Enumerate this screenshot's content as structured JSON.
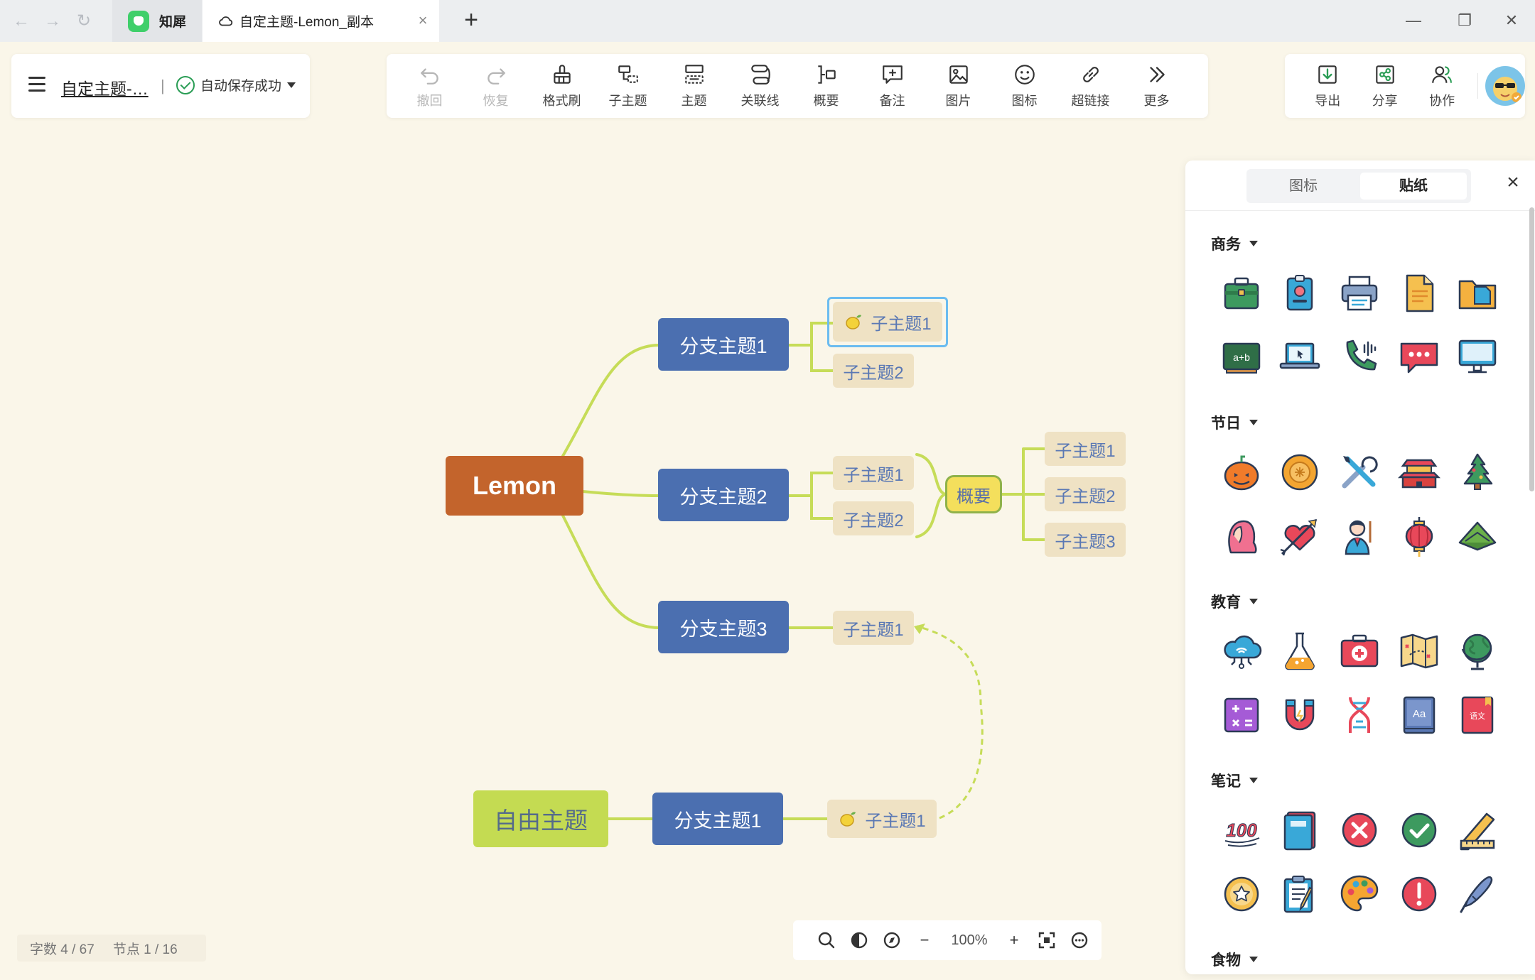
{
  "tabbar": {
    "app_tab_label": "知犀",
    "doc_tab_label": "自定主题-Lemon_副本",
    "new_tab": "+",
    "close_tab": "×",
    "back": "←",
    "forward": "→",
    "reload": "↻",
    "minimize": "—",
    "restore": "❐",
    "close_window": "✕"
  },
  "doc_panel": {
    "title": "自定主题-…",
    "separator": "|",
    "save_status": "自动保存成功"
  },
  "toolbar": {
    "items": [
      {
        "label": "撤回",
        "icon": "undo-icon",
        "disabled": true
      },
      {
        "label": "恢复",
        "icon": "redo-icon",
        "disabled": true
      },
      {
        "label": "格式刷",
        "icon": "format-brush-icon",
        "disabled": false
      },
      {
        "label": "子主题",
        "icon": "subtopic-icon",
        "disabled": false
      },
      {
        "label": "主题",
        "icon": "topic-icon",
        "disabled": false
      },
      {
        "label": "关联线",
        "icon": "relation-line-icon",
        "disabled": false
      },
      {
        "label": "概要",
        "icon": "summary-icon",
        "disabled": false
      },
      {
        "label": "备注",
        "icon": "note-icon",
        "disabled": false
      },
      {
        "label": "图片",
        "icon": "image-icon",
        "disabled": false
      },
      {
        "label": "图标",
        "icon": "emoji-icon",
        "disabled": false
      },
      {
        "label": "超链接",
        "icon": "link-icon",
        "disabled": false
      },
      {
        "label": "更多",
        "icon": "more-icon",
        "disabled": false
      }
    ]
  },
  "right_panel": {
    "export_label": "导出",
    "share_label": "分享",
    "collab_label": "协作"
  },
  "mindmap": {
    "root": "Lemon",
    "branch1": "分支主题1",
    "branch1_sub1": "子主题1",
    "branch1_sub2": "子主题2",
    "branch2": "分支主题2",
    "branch2_sub1": "子主题1",
    "branch2_sub2": "子主题2",
    "summary": "概要",
    "summary_sub1": "子主题1",
    "summary_sub2": "子主题2",
    "summary_sub3": "子主题3",
    "branch3": "分支主题3",
    "branch3_sub1": "子主题1",
    "free_topic": "自由主题",
    "free_branch": "分支主题1",
    "free_sub1": "子主题1",
    "colors": {
      "root": "#c3642c",
      "branch": "#4b6fb0",
      "sub": "#efe2c4",
      "summary": "#f4df5c",
      "free": "#c4db52",
      "line": "#c6dc58"
    }
  },
  "sticker_panel": {
    "tab_icons": "图标",
    "tab_stickers": "贴纸",
    "close": "×",
    "categories": [
      {
        "name": "商务",
        "stickers": [
          "briefcase",
          "id-badge",
          "printer",
          "document",
          "folder",
          "blackboard",
          "laptop",
          "phone",
          "chat-bubble",
          "monitor"
        ]
      },
      {
        "name": "节日",
        "stickers": [
          "pumpkin",
          "mooncake",
          "tools",
          "gate-tower",
          "christmas-tree",
          "girl-hair",
          "heart-arrow",
          "teacher",
          "lantern",
          "zongzi"
        ]
      },
      {
        "name": "教育",
        "stickers": [
          "cloud-network",
          "flask",
          "first-aid-kit",
          "map",
          "globe",
          "calculator",
          "magnet",
          "dna",
          "dictionary",
          "chinese-book"
        ]
      },
      {
        "name": "笔记",
        "stickers": [
          "hundred",
          "notebook",
          "cross-mark",
          "check-mark",
          "ruler",
          "star-badge",
          "clipboard",
          "palette",
          "exclamation",
          "pen"
        ]
      },
      {
        "name": "食物",
        "stickers": []
      }
    ],
    "sticker_text": {
      "blackboard": "a+b",
      "dictionary": "Aa",
      "chinese-book": "语文",
      "hundred": "100"
    }
  },
  "status_bar": {
    "word_count": "字数  4 / 67",
    "node_count": "节点  1 / 16"
  },
  "zoom_bar": {
    "zoom_level": "100%",
    "minus": "−",
    "plus": "+"
  }
}
